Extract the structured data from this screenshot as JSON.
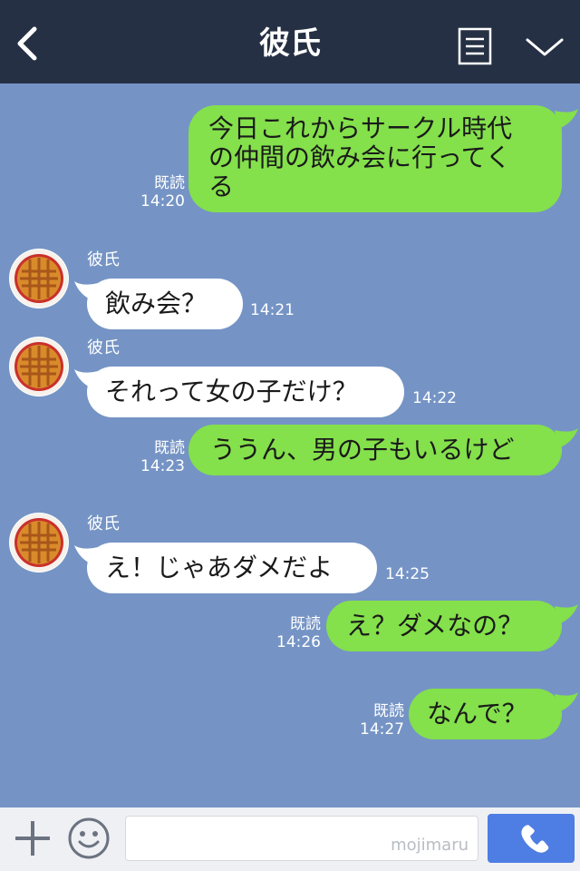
{
  "header": {
    "title": "彼氏"
  },
  "messages": [
    {
      "type": "out",
      "text": "今日これからサークル時代\nの仲間の飲み会に行ってく\nる",
      "read": "既読",
      "time": "14:20"
    },
    {
      "type": "in",
      "sender": "彼氏",
      "text": "飲み会？",
      "time": "14:21"
    },
    {
      "type": "in",
      "sender": "彼氏",
      "text": "それって女の子だけ？",
      "time": "14:22"
    },
    {
      "type": "out",
      "text": "ううん、男の子もいるけど",
      "read": "既読",
      "time": "14:23"
    },
    {
      "type": "in",
      "sender": "彼氏",
      "text": "え！じゃあダメだよ",
      "time": "14:25"
    },
    {
      "type": "out",
      "text": "え？ダメなの？",
      "read": "既読",
      "time": "14:26"
    },
    {
      "type": "out",
      "text": "なんで？",
      "read": "既読",
      "time": "14:27"
    }
  ],
  "input": {
    "watermark": "mojimaru"
  },
  "colors": {
    "header_bg": "#263044",
    "chat_bg": "#7594c5",
    "out_bubble": "#84e04b",
    "in_bubble": "#ffffff",
    "call_button": "#4e7de3"
  },
  "icons": [
    "back-arrow-icon",
    "menu-icon",
    "chevron-down-icon",
    "plus-icon",
    "smiley-icon",
    "phone-icon"
  ]
}
